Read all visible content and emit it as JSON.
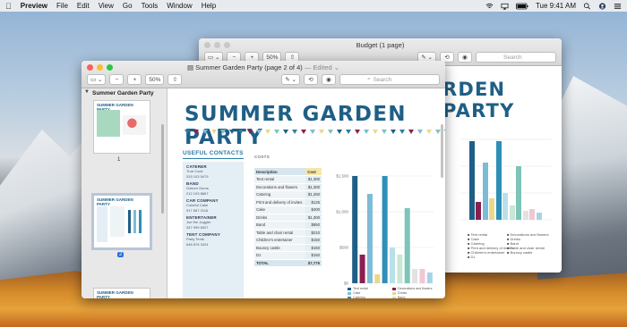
{
  "menubar": {
    "app": "Preview",
    "items": [
      "File",
      "Edit",
      "View",
      "Go",
      "Tools",
      "Window",
      "Help"
    ],
    "clock": "Tue 9:41 AM"
  },
  "back_window": {
    "title": "Budget (1 page)",
    "zoom": "50%",
    "search_placeholder": "Search",
    "doc_title": "RDEN PARTY"
  },
  "front_window": {
    "title": "Summer Garden Party (page 2 of 4)",
    "edited": "— Edited ⌄",
    "zoom": "50%",
    "search_placeholder": "Search",
    "sidebar": {
      "doc_name": "Summer Garden Party",
      "pages": [
        "1",
        "2"
      ]
    },
    "doc": {
      "title": "SUMMER GARDEN PARTY",
      "contacts_heading": "USEFUL CONTACTS",
      "costs_heading": "COSTS",
      "contacts": [
        {
          "h": "CATERER",
          "l1": "True Cook",
          "l2": "315 103 5479"
        },
        {
          "h": "BAND",
          "l1": "Guitum Gurus",
          "l2": "212 103 8667"
        },
        {
          "h": "CAR COMPANY",
          "l1": "Colorful Cake",
          "l2": "917 867 2116"
        },
        {
          "h": "ENTERTAINER",
          "l1": "Joe the Juggler",
          "l2": "347 999 6927"
        },
        {
          "h": "TENT COMPANY",
          "l1": "Party Tents",
          "l2": "646 876 3424"
        }
      ],
      "costs_table": {
        "headers": [
          "Description",
          "Cost"
        ],
        "rows": [
          [
            "Tent rental",
            "$1,300"
          ],
          [
            "Decorations and flowers",
            "$1,300"
          ],
          [
            "Catering",
            "$1,250"
          ],
          [
            "Print and delivery of invites",
            "$125"
          ],
          [
            "Cake",
            "$400"
          ],
          [
            "Drinks",
            "$1,300"
          ],
          [
            "Band",
            "$850"
          ],
          [
            "Table and chair rental",
            "$210"
          ],
          [
            "Children's entertainer",
            "$150"
          ],
          [
            "Bouncy castle",
            "$150"
          ],
          [
            "DJ",
            "$150"
          ]
        ],
        "total": [
          "TOTAL",
          "$7,775"
        ]
      },
      "chart_data": {
        "type": "bar",
        "categories": [
          "Tent rental",
          "Cake",
          "Print and delivery of invites",
          "Children's entertainer",
          "DJ",
          "Decorations and flowers",
          "Drinks",
          "Table and chair rental",
          "Catering",
          "Band",
          "Bouncy castle"
        ],
        "values": [
          1500,
          400,
          1250,
          125,
          1500,
          500,
          400,
          1050,
          200,
          200,
          150
        ],
        "ylim": [
          0,
          1500
        ],
        "yticks": [
          "$0",
          "$500",
          "$1,000",
          "$1,500"
        ],
        "colors": [
          "#1f5f86",
          "#8a1f4f",
          "#7dbbd6",
          "#e8d98a",
          "#2e8fb8",
          "#b9e0ea",
          "#c9e6d6",
          "#7cc5b8",
          "#e2e2e2",
          "#f0c7d3",
          "#a7d4e4"
        ],
        "legend": [
          "Tent rental",
          "Decorations and flowers",
          "Cake",
          "Drinks",
          "Catering",
          "Band",
          "Print and delivery of invites",
          "Table and chair rental",
          "Children's entertainer",
          "Bouncy castle",
          "DJ"
        ]
      }
    }
  }
}
